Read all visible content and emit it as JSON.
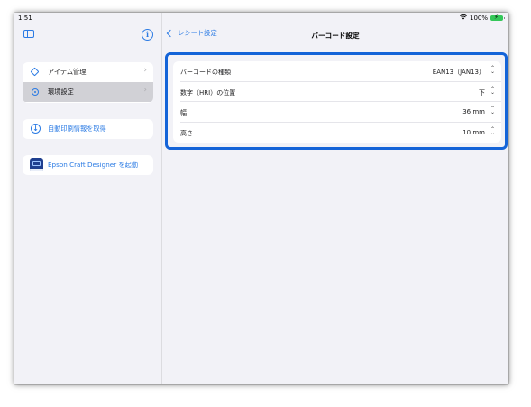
{
  "status": {
    "time": "1:51",
    "wifi_icon": "wifi-icon",
    "battery": "100%"
  },
  "sidebar": {
    "toggle_icon": "sidebar-icon",
    "info_icon": "info-icon",
    "info_glyph": "i",
    "menu": [
      {
        "label": "アイテム管理",
        "icon": "tag-icon",
        "selected": false
      },
      {
        "label": "環境設定",
        "icon": "gear-icon",
        "selected": true
      }
    ],
    "auto_print": {
      "label": "自動印刷情報を取得",
      "icon": "download-icon",
      "glyph": "↓"
    },
    "craft_designer": {
      "label": "Epson Craft Designer を起動",
      "icon": "app-icon"
    }
  },
  "navbar": {
    "back_label": "レシート設定",
    "title": "バーコード設定"
  },
  "settings": [
    {
      "label": "バーコードの種類",
      "value": "EAN13（JAN13）"
    },
    {
      "label": "数字（HRI）の位置",
      "value": "下"
    },
    {
      "label": "幅",
      "value": "36 mm"
    },
    {
      "label": "高さ",
      "value": "10 mm"
    }
  ],
  "colors": {
    "accent": "#2b7be4",
    "highlight": "#1464d8",
    "battery": "#34c759"
  }
}
